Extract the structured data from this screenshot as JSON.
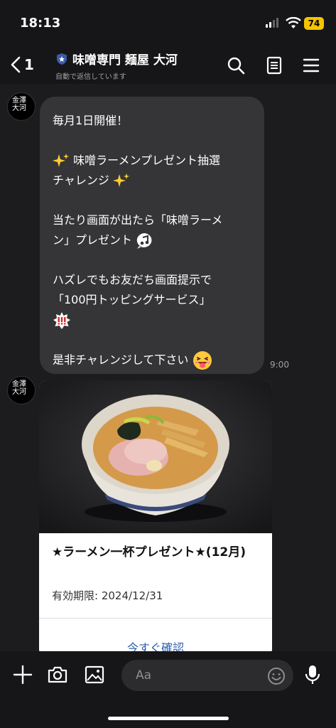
{
  "status": {
    "time": "18:13",
    "battery": "74"
  },
  "header": {
    "back_count": "1",
    "title": "味噌専門 麺屋 大河",
    "subtitle": "自動で返信しています"
  },
  "avatar": {
    "logo_text": "金澤 大河"
  },
  "message": {
    "lines": {
      "l1": "毎月1日開催！",
      "l2": "味噌ラーメンプレゼント抽選",
      "l3": "チャレンジ",
      "l4": "当たり画面が出たら「味噌ラーメ",
      "l5": "ン」プレゼント",
      "l6": "ハズレでもお友だち画面提示で",
      "l7": "「100円トッピングサービス」",
      "l8": "是非チャレンジして下さい"
    },
    "time": "9:00"
  },
  "card": {
    "title": "★ラーメン一杯プレゼント★(12月)",
    "expiry": "有効期限: 2024/12/31",
    "link": "今すぐ確認"
  },
  "input": {
    "placeholder": "Aa"
  },
  "colors": {
    "link": "#2a5caa",
    "bubble": "#353537",
    "battery": "#f5c400",
    "background": "#1c1c1e"
  }
}
